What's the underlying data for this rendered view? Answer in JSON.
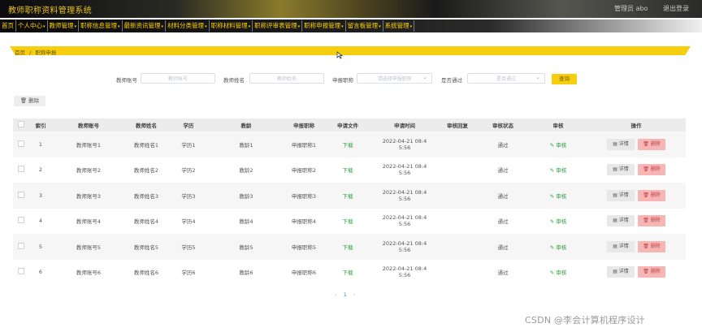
{
  "app": {
    "title": "教师职称资料管理系统",
    "user_label": "管理员 abo",
    "logout_label": "退出登录"
  },
  "nav": [
    "首页",
    "个人中心",
    "教师管理",
    "职称信息管理",
    "最新资讯管理",
    "材料分类管理",
    "职称材料管理",
    "职称评审表管理",
    "职称申报管理",
    "留言板管理",
    "系统管理"
  ],
  "breadcrumb": {
    "home": "首页",
    "sep": "/",
    "current": "职称申报"
  },
  "search": {
    "account_label": "教师账号",
    "account_placeholder": "教师账号",
    "name_label": "教师姓名",
    "name_placeholder": "教师姓名",
    "title_label": "申报职称",
    "title_placeholder": "请选择申报职称",
    "passed_label": "是否通过",
    "passed_placeholder": "是否通过",
    "query_button": "查询"
  },
  "toolbar": {
    "delete_button": "删除"
  },
  "table": {
    "headers": [
      "索引",
      "教师账号",
      "教师姓名",
      "学历",
      "教龄",
      "申报职称",
      "申请文件",
      "申请时间",
      "审核回复",
      "审核状态",
      "审核",
      "操作"
    ],
    "rows": [
      {
        "index": "1",
        "account": "教师账号1",
        "name": "教师姓名1",
        "edu": "学历1",
        "years": "教龄1",
        "title": "申报职称1",
        "file": "下载",
        "time_a": "2022-04-21 08:4",
        "time_b": "5:56",
        "reply": "",
        "status": "通过",
        "review": "审核",
        "detail": "详情",
        "del": "删除"
      },
      {
        "index": "2",
        "account": "教师账号2",
        "name": "教师姓名2",
        "edu": "学历2",
        "years": "教龄2",
        "title": "申报职称2",
        "file": "下载",
        "time_a": "2022-04-21 08:4",
        "time_b": "5:56",
        "reply": "",
        "status": "通过",
        "review": "审核",
        "detail": "详情",
        "del": "删除"
      },
      {
        "index": "3",
        "account": "教师账号3",
        "name": "教师姓名3",
        "edu": "学历3",
        "years": "教龄3",
        "title": "申报职称3",
        "file": "下载",
        "time_a": "2022-04-21 08:4",
        "time_b": "5:56",
        "reply": "",
        "status": "通过",
        "review": "审核",
        "detail": "详情",
        "del": "删除"
      },
      {
        "index": "4",
        "account": "教师账号4",
        "name": "教师姓名4",
        "edu": "学历4",
        "years": "教龄4",
        "title": "申报职称4",
        "file": "下载",
        "time_a": "2022-04-21 08:4",
        "time_b": "5:56",
        "reply": "",
        "status": "通过",
        "review": "审核",
        "detail": "详情",
        "del": "删除"
      },
      {
        "index": "5",
        "account": "教师账号5",
        "name": "教师姓名5",
        "edu": "学历5",
        "years": "教龄5",
        "title": "申报职称5",
        "file": "下载",
        "time_a": "2022-04-21 08:4",
        "time_b": "5:56",
        "reply": "",
        "status": "通过",
        "review": "审核",
        "detail": "详情",
        "del": "删除"
      },
      {
        "index": "6",
        "account": "教师账号6",
        "name": "教师姓名6",
        "edu": "学历6",
        "years": "教龄6",
        "title": "申报职称6",
        "file": "下载",
        "time_a": "2022-04-21 08:4",
        "time_b": "5:56",
        "reply": "",
        "status": "通过",
        "review": "审核",
        "detail": "详情",
        "del": "删除"
      }
    ]
  },
  "pager": {
    "prev": "‹",
    "current": "1",
    "next": "›"
  },
  "watermark": "CSDN @李会计算机程序设计",
  "colors": {
    "accent": "#f7ce0e",
    "nav_text": "#ffd200",
    "success": "#2f9e44",
    "danger_bg": "#f7b5b5"
  }
}
